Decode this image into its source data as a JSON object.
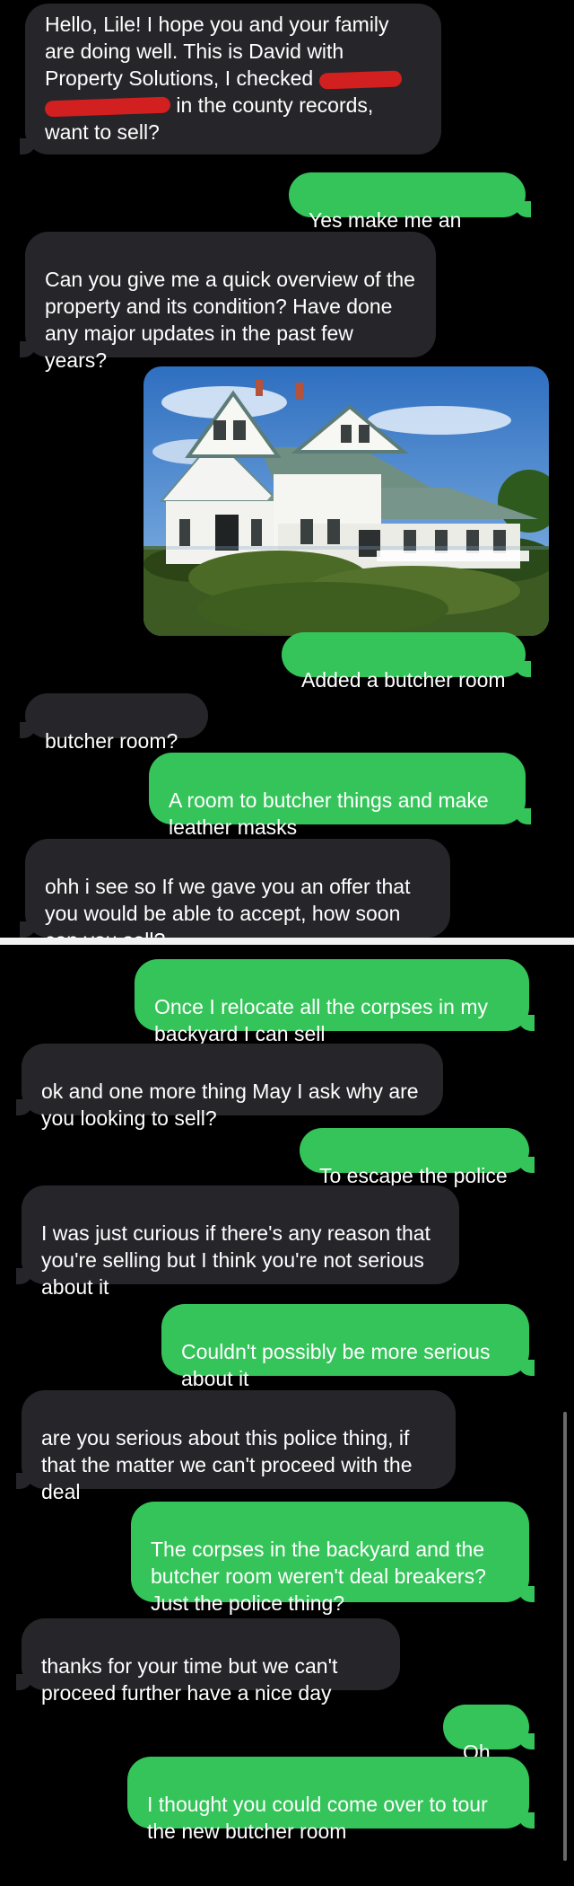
{
  "panel1": {
    "messages": [
      {
        "dir": "in",
        "pre": "Hello, Lile! I hope you and your family are doing well. This is David with Property Solutions, I checked",
        "mid": "in the county records,",
        "post": "want to sell?"
      },
      {
        "dir": "out",
        "text": "Yes make me an offer"
      },
      {
        "dir": "in",
        "text": "Can you give me a quick overview of the property and its condition? Have done any major updates in the past few years?"
      },
      {
        "dir": "out",
        "text": "Added a butcher room"
      },
      {
        "dir": "in",
        "text": "butcher room?"
      },
      {
        "dir": "out",
        "text": "A room to butcher things and make leather masks"
      },
      {
        "dir": "in",
        "text": "ohh i see so  If we gave you an offer that you would be able to accept, how soon can you sell?"
      }
    ]
  },
  "panel2": {
    "messages": [
      {
        "dir": "out",
        "text": "Once I relocate all the corpses in my backyard I can sell"
      },
      {
        "dir": "in",
        "text": "ok and one more thing May I ask why are you looking to sell?"
      },
      {
        "dir": "out",
        "text": "To escape the police"
      },
      {
        "dir": "in",
        "text": "I was just curious if there's any reason that you're selling but I think you're not serious about it"
      },
      {
        "dir": "out",
        "text": "Couldn't possibly be more serious about it"
      },
      {
        "dir": "in",
        "text": "are you serious about this police thing, if that the matter we can't proceed with the deal"
      },
      {
        "dir": "out",
        "text": "The corpses in the backyard and the butcher room weren't deal breakers? Just the police thing?"
      },
      {
        "dir": "in",
        "text": "thanks for your time but we can't proceed further have a nice day"
      },
      {
        "dir": "out",
        "text": "Oh no!"
      },
      {
        "dir": "out",
        "text": "I thought you could come over to tour the new butcher room"
      }
    ]
  },
  "colors": {
    "outgoing": "#35c45a",
    "incoming": "#26252a",
    "background": "#000000",
    "redaction": "#d21f1f"
  },
  "icons": {
    "photo": "house-photo"
  }
}
